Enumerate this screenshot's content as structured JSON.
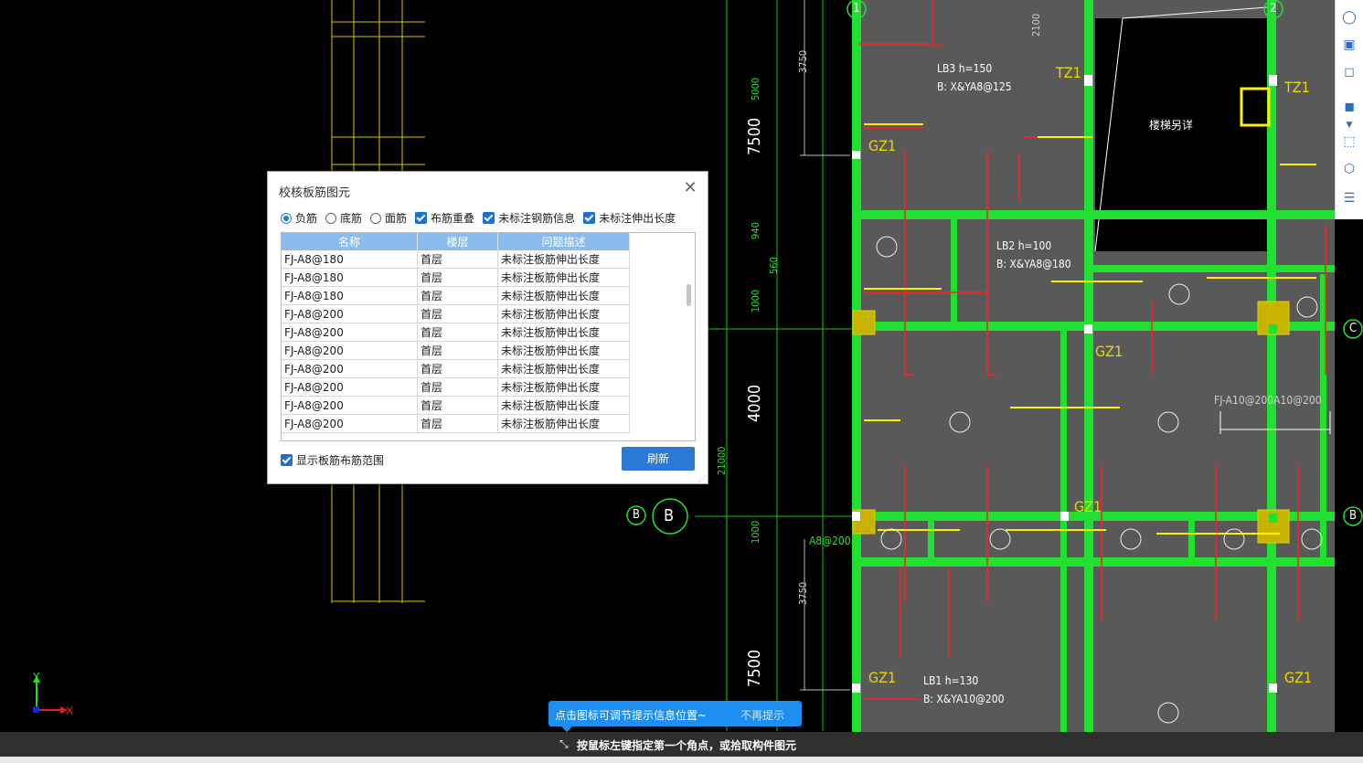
{
  "dialog": {
    "title": "校核板筋图元",
    "radios": [
      {
        "label": "负筋",
        "checked": true
      },
      {
        "label": "底筋",
        "checked": false
      },
      {
        "label": "面筋",
        "checked": false
      }
    ],
    "checks": [
      {
        "label": "布筋重叠",
        "checked": true
      },
      {
        "label": "未标注钢筋信息",
        "checked": true
      },
      {
        "label": "未标注伸出长度",
        "checked": true
      }
    ],
    "columns": [
      "名称",
      "楼层",
      "问题描述"
    ],
    "rows": [
      [
        "FJ-A8@180",
        "首层",
        "未标注板筋伸出长度"
      ],
      [
        "FJ-A8@180",
        "首层",
        "未标注板筋伸出长度"
      ],
      [
        "FJ-A8@180",
        "首层",
        "未标注板筋伸出长度"
      ],
      [
        "FJ-A8@200",
        "首层",
        "未标注板筋伸出长度"
      ],
      [
        "FJ-A8@200",
        "首层",
        "未标注板筋伸出长度"
      ],
      [
        "FJ-A8@200",
        "首层",
        "未标注板筋伸出长度"
      ],
      [
        "FJ-A8@200",
        "首层",
        "未标注板筋伸出长度"
      ],
      [
        "FJ-A8@200",
        "首层",
        "未标注板筋伸出长度"
      ],
      [
        "FJ-A8@200",
        "首层",
        "未标注板筋伸出长度"
      ],
      [
        "FJ-A8@200",
        "首层",
        "未标注板筋伸出长度"
      ]
    ],
    "show_range_label": "显示板筋布筋范围",
    "refresh_label": "刷新"
  },
  "hint": {
    "message": "点击图标可调节提示信息位置~",
    "dismiss": "不再提示"
  },
  "status": {
    "prompt": "按鼠标左键指定第一个角点，或拾取构件图元"
  },
  "cad": {
    "dims": [
      "3750",
      "5000",
      "7500",
      "940",
      "560",
      "1000",
      "4000",
      "21000",
      "1000",
      "3750",
      "7500",
      "2100"
    ],
    "labels": [
      "LB3 h=150",
      "B: X&YA8@125",
      "LB2 h=100",
      "B: X&YA8@180",
      "LB1 h=130",
      "B: X&YA10@200",
      "FJ-A10@200A10@200",
      "楼梯另详",
      "A8@200"
    ],
    "columns": [
      "GZ1",
      "TZ1"
    ],
    "grid_marks": [
      "1",
      "2",
      "B",
      "C"
    ],
    "axis": {
      "x": "X",
      "y": "Y"
    },
    "colors": {
      "beam": "#22e030",
      "slab": "#595959",
      "rebar_red": "#ff2020",
      "rebar_yellow": "#ffee00",
      "text_yellow": "#e8d800",
      "text_cyan": "#18a0a0"
    }
  },
  "toolbar": {
    "icons": [
      "view-sphere-icon",
      "3d-icon",
      "box-icon",
      "box-solid-icon",
      "chevron-down-icon",
      "select-region-icon",
      "cube-icon",
      "list-icon"
    ]
  }
}
